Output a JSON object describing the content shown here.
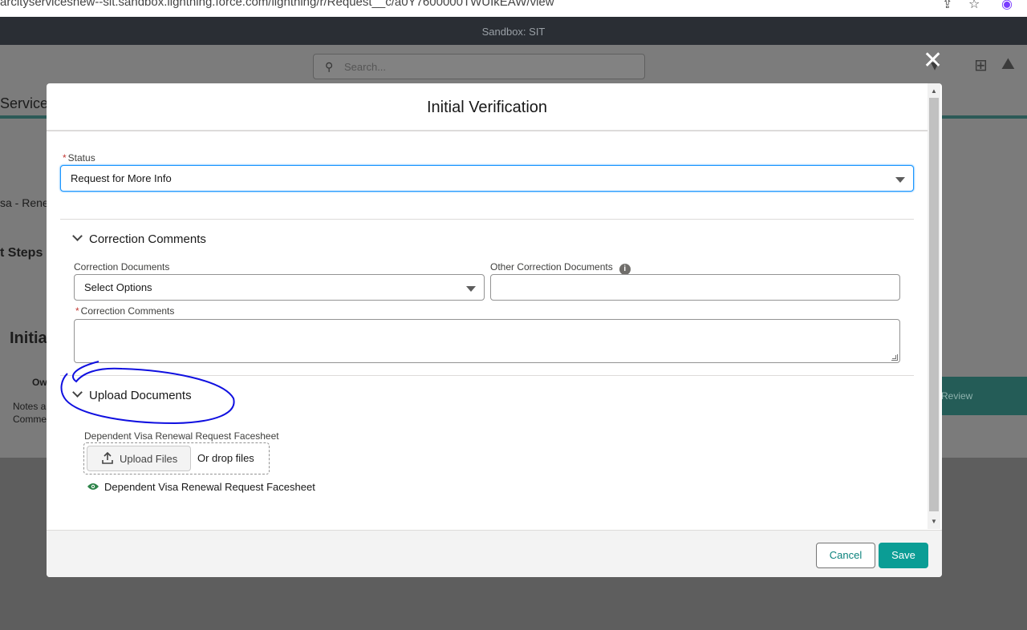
{
  "browser": {
    "url": "arcityservicesnew--sit.sandbox.lightning.force.com/lightning/r/Request__c/a0Y7600000TWUIkEAW/view"
  },
  "sandbox_banner": "Sandbox: SIT",
  "background": {
    "search_placeholder": "Search...",
    "app_name_fragment": "Services",
    "record_title_fragment": "sa - Rene",
    "steps_fragment": "t Steps",
    "initial_fragment": "Initia",
    "owner_fragment": "Ow",
    "notes_fragment": "Notes a",
    "comments_fragment": "Comme",
    "review_fragment": "Review"
  },
  "modal": {
    "title": "Initial Verification",
    "status": {
      "label": "Status",
      "value": "Request for More Info"
    },
    "correction_section": {
      "title": "Correction Comments",
      "documents_label": "Correction Documents",
      "documents_value": "Select Options",
      "other_documents_label": "Other Correction Documents",
      "comments_label": "Correction Comments"
    },
    "upload_section": {
      "title": "Upload Documents",
      "field_label": "Dependent Visa Renewal Request Facesheet",
      "upload_button": "Upload Files",
      "drop_text": "Or drop files",
      "file_name": "Dependent Visa Renewal Request Facesheet"
    },
    "footer": {
      "cancel": "Cancel",
      "save": "Save"
    }
  },
  "colors": {
    "brand_teal": "#0b9d95",
    "required": "#c23934",
    "focus": "#1b96ff",
    "annotation": "#1010e0"
  }
}
